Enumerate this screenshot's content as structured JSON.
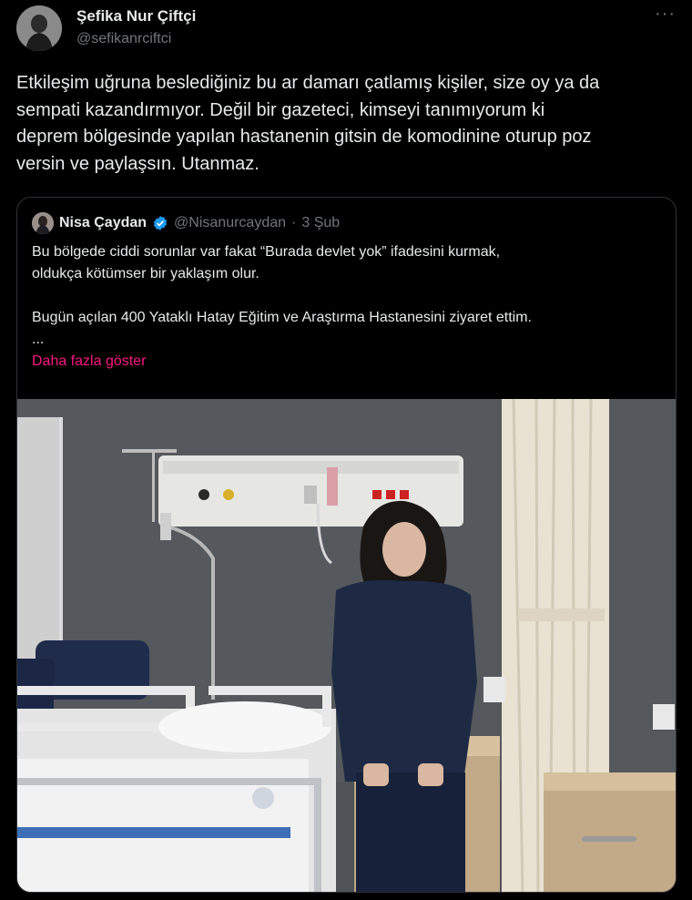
{
  "tweet": {
    "author_name": "Şefika Nur Çiftçi",
    "author_handle": "@sefikanrciftci",
    "more_label": "···",
    "text_lines": [
      "Etkileşim uğruna beslediğiniz bu ar damarı çatlamış kişiler, size oy ya da",
      "sempati kazandırmıyor. Değil bir gazeteci, kimseyi tanımıyorum ki",
      "deprem bölgesinde yapılan hastanenin gitsin de komodinine oturup poz",
      "versin ve paylaşsın. Utanmaz."
    ]
  },
  "quote": {
    "author_name": "Nisa Çaydan",
    "author_handle": "@Nisanurcaydan",
    "separator": "·",
    "date": "3 Şub",
    "line1": "Bu bölgede ciddi sorunlar var fakat “Burada devlet yok” ifadesini kurmak,",
    "line2": "oldukça kötümser bir yaklaşım olur.",
    "line3": "Bugün açılan 400 Yataklı Hatay Eğitim ve Araştırma Hastanesini ziyaret ettim.",
    "ellipsis": "...",
    "show_more": "Daha fazla göster"
  },
  "colors": {
    "background": "#000000",
    "text": "#e7e9ea",
    "muted": "#71767b",
    "link": "#f91880",
    "verified": "#1d9bf0",
    "border": "#2f3336"
  },
  "icons": [
    "more-icon",
    "verified-badge-icon"
  ]
}
